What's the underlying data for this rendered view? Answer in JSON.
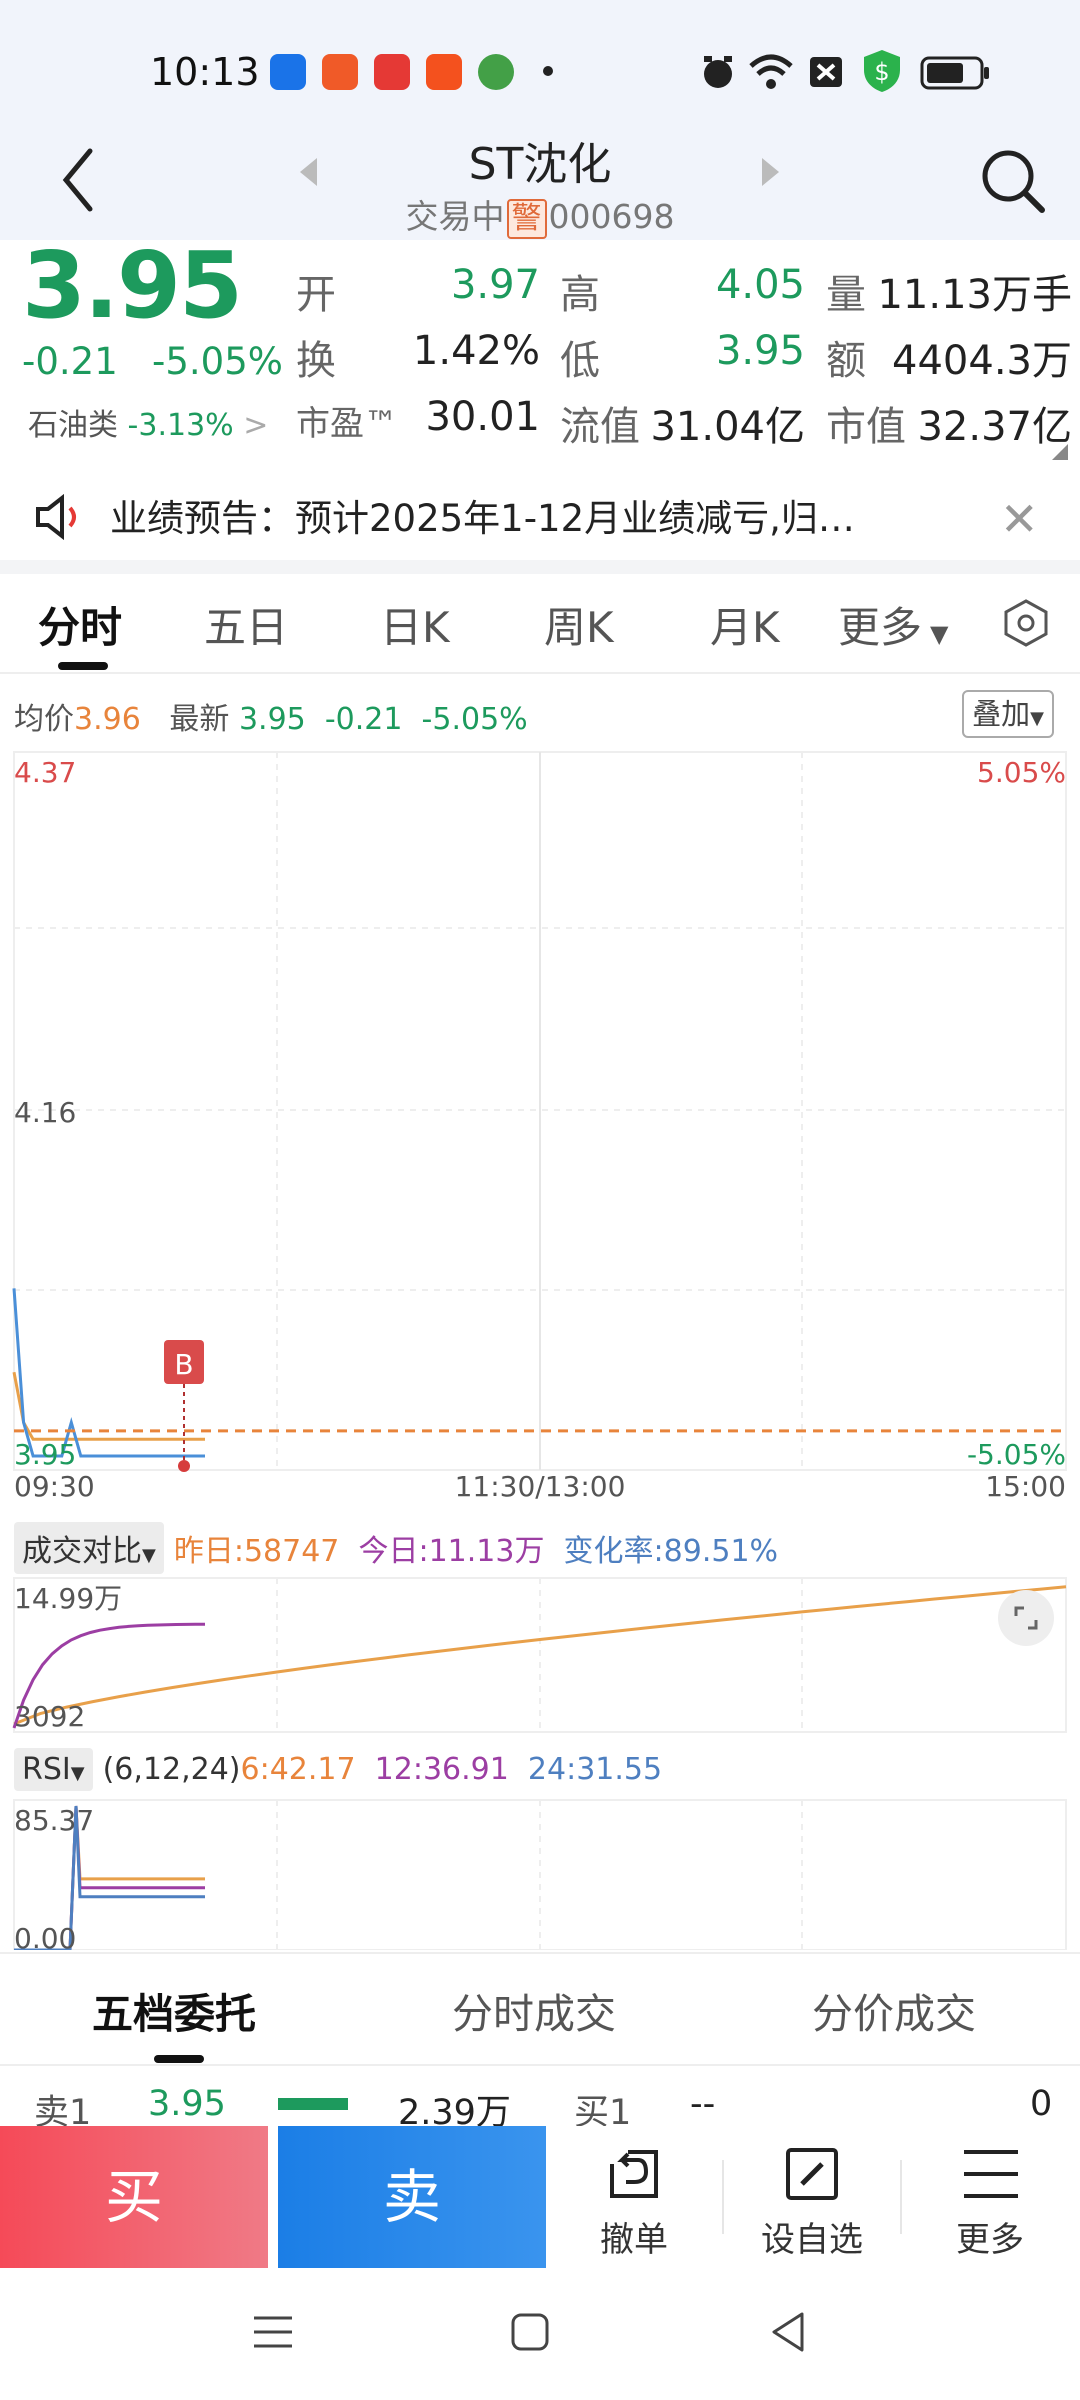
{
  "status": {
    "time": "10:13"
  },
  "header": {
    "name": "ST沈化",
    "trade_state": "交易中",
    "warn": "警",
    "code": "000698"
  },
  "quote": {
    "price": "3.95",
    "change": "-0.21",
    "change_pct": "-5.05%",
    "sector": "石油类",
    "sector_chg": "-3.13%",
    "open_label": "开",
    "open": "3.97",
    "high_label": "高",
    "high": "4.05",
    "vol_label": "量",
    "vol": "11.13万手",
    "turn_label": "换",
    "turn": "1.42%",
    "low_label": "低",
    "low": "3.95",
    "amt_label": "额",
    "amt": "4404.3万",
    "pe_label": "市盈™",
    "pe": "30.01",
    "float_label": "流值",
    "float": "31.04亿",
    "mcap_label": "市值",
    "mcap": "32.37亿"
  },
  "notice": {
    "text": "业绩预告：预计2025年1-12月业绩减亏,归…"
  },
  "tabs": [
    "分时",
    "五日",
    "日K",
    "周K",
    "月K",
    "更多"
  ],
  "info": {
    "avg_label": "均价",
    "avg": "3.96",
    "last_label": "最新",
    "last": "3.95",
    "chg": "-0.21",
    "pct": "-5.05%",
    "overlay": "叠加"
  },
  "chart_data": {
    "type": "line",
    "y_max_label": "4.37",
    "y_mid_label": "4.16",
    "y_min_label": "3.95",
    "pct_max_label": "5.05%",
    "pct_min_label": "-5.05%",
    "x_labels": [
      "09:30",
      "11:30/13:00",
      "15:00"
    ],
    "marker": "B",
    "series": [
      {
        "values": [
          4.0,
          3.97,
          3.96,
          3.96,
          3.96,
          3.96,
          3.96,
          3.96,
          3.96,
          3.96,
          3.96,
          3.96,
          3.96,
          3.96,
          3.96,
          3.96,
          3.96,
          3.96,
          3.96,
          3.96,
          3.96
        ]
      },
      {
        "values": [
          4.05,
          3.97,
          3.95,
          3.95,
          3.95,
          3.95,
          3.97,
          3.95,
          3.95,
          3.95,
          3.95,
          3.95,
          3.95,
          3.95,
          3.95,
          3.95,
          3.95,
          3.95,
          3.95,
          3.95,
          3.95
        ]
      }
    ]
  },
  "volume": {
    "selector": "成交对比",
    "yesterday": "昨日:58747",
    "today": "今日:11.13万",
    "rate": "变化率:89.51%",
    "max_label": "14.99万",
    "min_label": "3092"
  },
  "rsi": {
    "selector": "RSI",
    "params": "(6,12,24)",
    "r6": "6:42.17",
    "r12": "12:36.91",
    "r24": "24:31.55",
    "max_label": "85.37",
    "min_label": "0.00"
  },
  "bottom_tabs": [
    "五档委托",
    "分时成交",
    "分价成交"
  ],
  "orderbook": {
    "ask_label": "卖1",
    "ask_price": "3.95",
    "ask_vol": "2.39万",
    "bid_label": "买1",
    "bid_price": "--",
    "bid_vol": "0"
  },
  "actions": {
    "buy": "买",
    "sell": "卖",
    "cancel": "撤单",
    "watch": "设自选",
    "more": "更多"
  }
}
